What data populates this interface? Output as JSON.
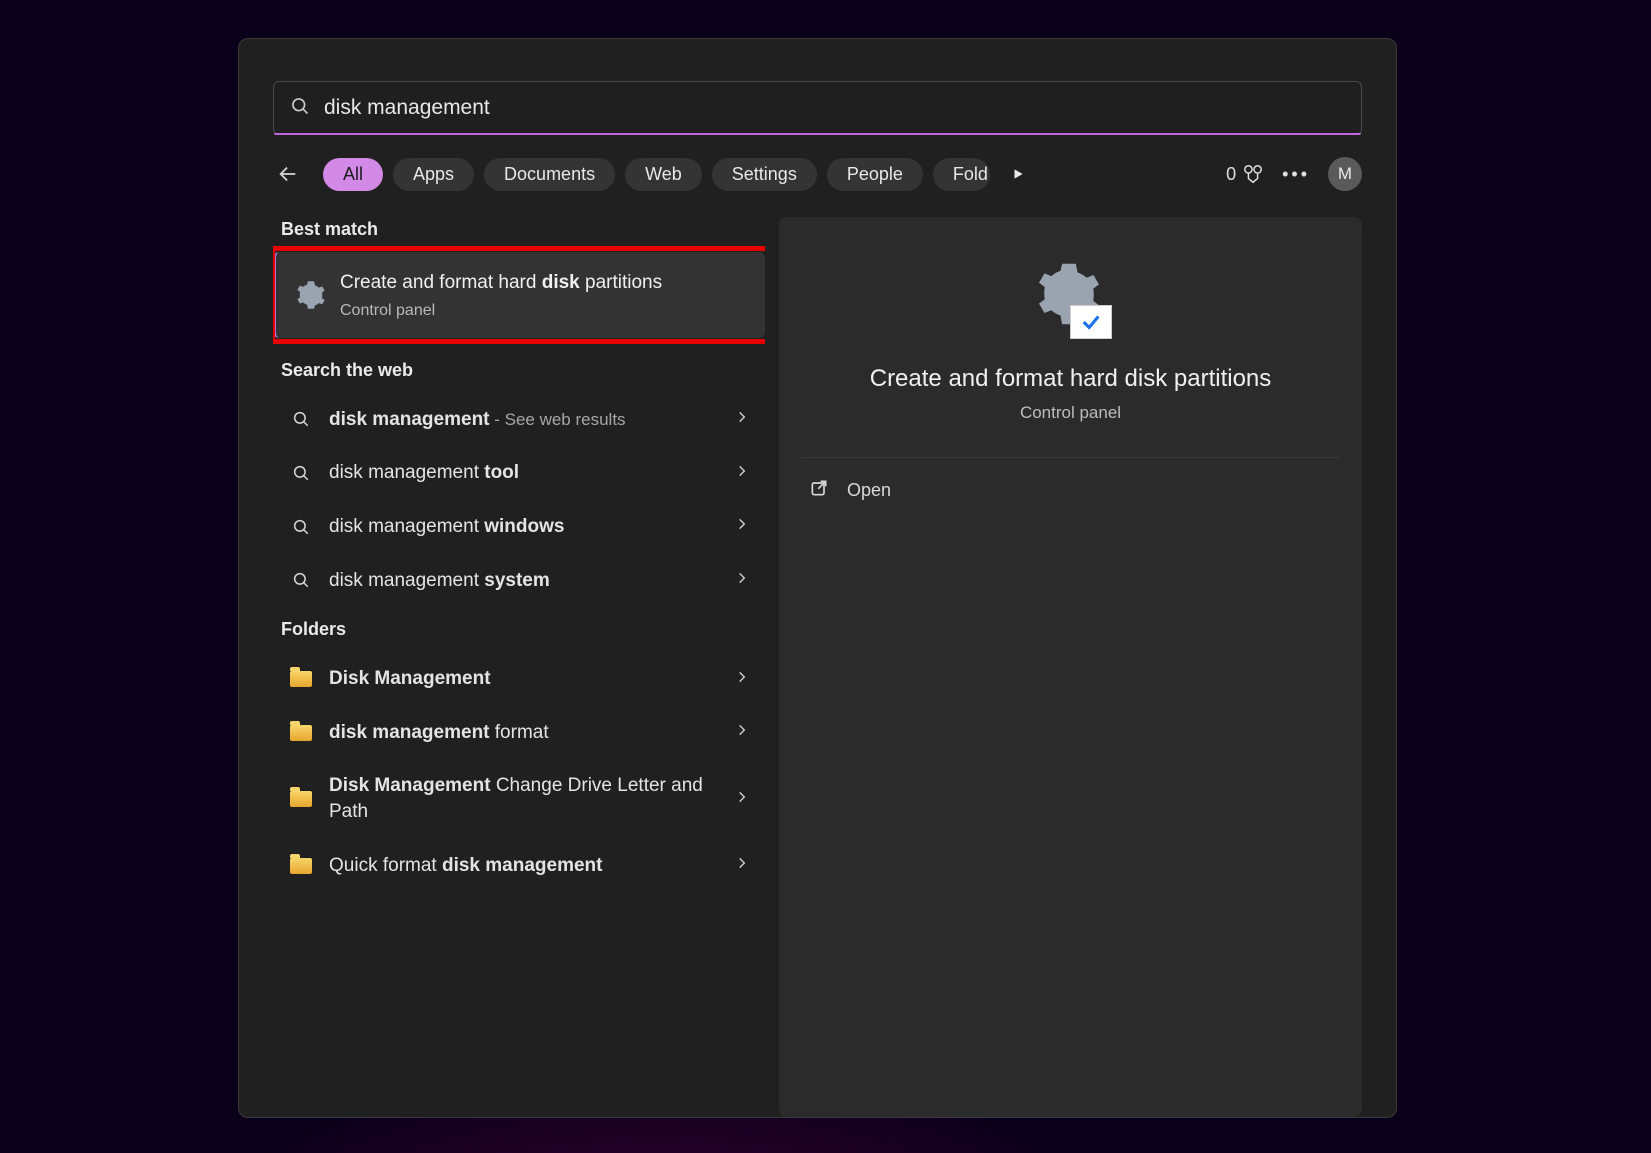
{
  "search": {
    "value": "disk management"
  },
  "filters": {
    "items": [
      "All",
      "Apps",
      "Documents",
      "Web",
      "Settings",
      "People",
      "Fold"
    ],
    "active_index": 0
  },
  "header_right": {
    "rewards_count": "0",
    "avatar_letter": "M"
  },
  "sections": {
    "best_match_label": "Best match",
    "search_web_label": "Search the web",
    "folders_label": "Folders"
  },
  "best_match": {
    "title_prefix": "Create and format hard ",
    "title_bold": "disk",
    "title_suffix": " partitions",
    "subtitle": "Control panel"
  },
  "web_results": [
    {
      "prefix": "",
      "bold": "disk management",
      "suffix": "",
      "trail": " - See web results"
    },
    {
      "prefix": "disk management ",
      "bold": "tool",
      "suffix": "",
      "trail": ""
    },
    {
      "prefix": "disk management ",
      "bold": "windows",
      "suffix": "",
      "trail": ""
    },
    {
      "prefix": "disk management ",
      "bold": "system",
      "suffix": "",
      "trail": ""
    }
  ],
  "folders": [
    {
      "prefix": "",
      "bold": "Disk Management",
      "suffix": ""
    },
    {
      "prefix": "",
      "bold": "disk management",
      "suffix": " format"
    },
    {
      "prefix": "",
      "bold": "Disk Management",
      "suffix": " Change Drive Letter and Path"
    },
    {
      "prefix": "Quick format ",
      "bold": "disk management",
      "suffix": ""
    }
  ],
  "preview": {
    "title": "Create and format hard disk partitions",
    "subtitle": "Control panel",
    "open_label": "Open"
  }
}
